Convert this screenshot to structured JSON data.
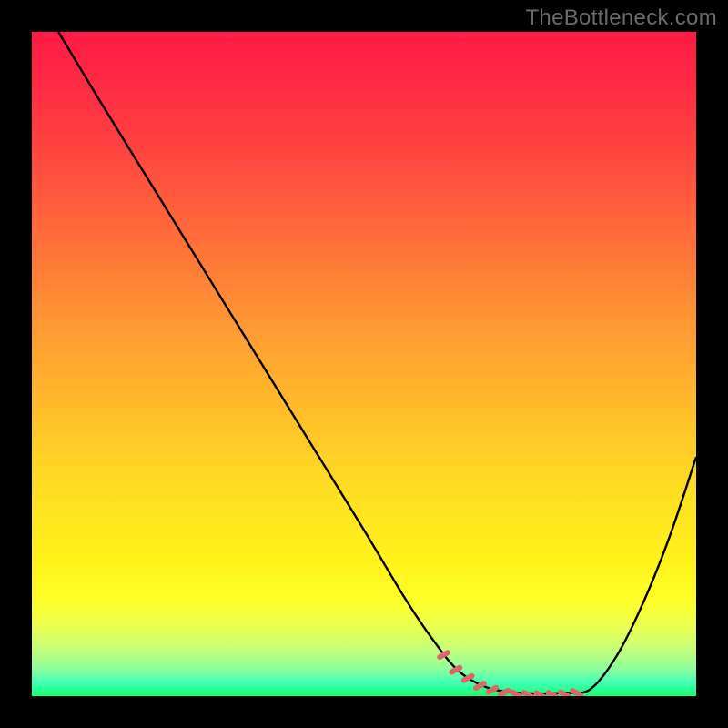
{
  "watermark": "TheBottleneck.com",
  "chart_data": {
    "type": "line",
    "title": "",
    "xlabel": "",
    "ylabel": "",
    "xlim": [
      0,
      100
    ],
    "ylim": [
      0,
      100
    ],
    "series": [
      {
        "name": "bottleneck-curve",
        "x": [
          4,
          10,
          18,
          26,
          34,
          42,
          50,
          56,
          60,
          64,
          68,
          72,
          76,
          80,
          84,
          88,
          92,
          96,
          100
        ],
        "y": [
          100,
          90,
          77,
          64,
          51,
          38,
          25,
          15,
          9,
          4,
          1.5,
          0.6,
          0.4,
          0.5,
          1.0,
          6,
          14,
          24,
          36
        ]
      }
    ],
    "highlight": {
      "name": "valley-mask",
      "x_range": [
        62,
        82
      ],
      "style": "red-dashed-bottom"
    },
    "gradient": {
      "top_color": "#ff1a46",
      "mid_color": "#ffe021",
      "bottom_color": "#17ff6a"
    }
  }
}
